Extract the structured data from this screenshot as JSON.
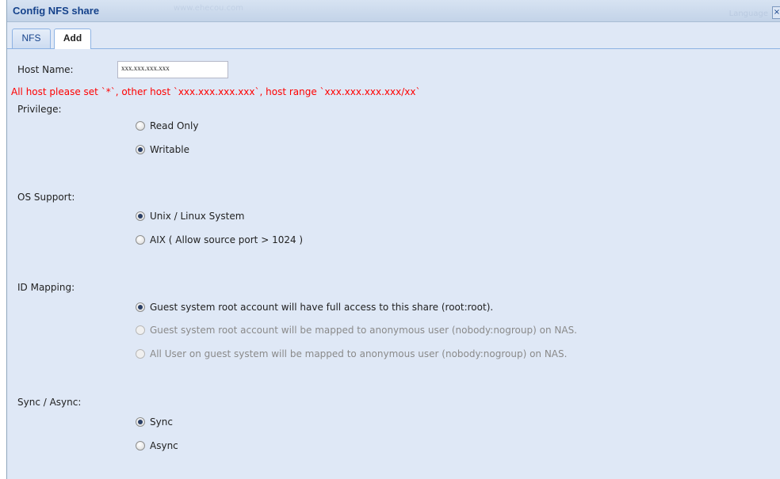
{
  "window": {
    "title": "Config NFS share",
    "watermark": "www.ehecou.com",
    "right_watermark": "Language",
    "close_symbol": "×"
  },
  "tabs": [
    {
      "label": "NFS",
      "active": false
    },
    {
      "label": "Add",
      "active": true
    }
  ],
  "host": {
    "label": "Host Name:",
    "value": "xxx.xxx.xxx.xxx",
    "hint": "All host please set `*`, other host `xxx.xxx.xxx.xxx`, host range `xxx.xxx.xxx.xxx/xx`"
  },
  "privilege": {
    "label": "Privilege:",
    "options": [
      {
        "label": "Read Only",
        "selected": false,
        "disabled": false
      },
      {
        "label": "Writable",
        "selected": true,
        "disabled": false
      }
    ]
  },
  "os_support": {
    "label": "OS Support:",
    "options": [
      {
        "label": "Unix / Linux System",
        "selected": true,
        "disabled": false
      },
      {
        "label": "AIX ( Allow source port > 1024 )",
        "selected": false,
        "disabled": false
      }
    ]
  },
  "id_mapping": {
    "label": "ID Mapping:",
    "options": [
      {
        "label": "Guest system root account will have full access to this share (root:root).",
        "selected": true,
        "disabled": false
      },
      {
        "label": "Guest system root account will be mapped to anonymous user (nobody:nogroup) on NAS.",
        "selected": false,
        "disabled": true
      },
      {
        "label": "All User on guest system will be mapped to anonymous user (nobody:nogroup) on NAS.",
        "selected": false,
        "disabled": true
      }
    ]
  },
  "sync": {
    "label": "Sync / Async:",
    "options": [
      {
        "label": "Sync",
        "selected": true,
        "disabled": false
      },
      {
        "label": "Async",
        "selected": false,
        "disabled": false
      }
    ]
  }
}
